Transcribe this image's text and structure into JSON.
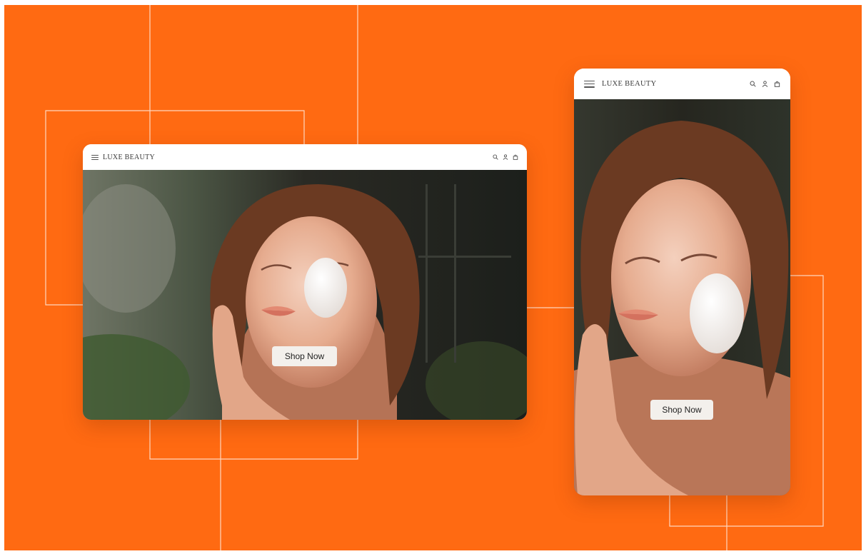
{
  "colors": {
    "background": "#ff6a12",
    "line": "#ffd7bf",
    "navbar": "#ffffff",
    "button": "#f3f0ec"
  },
  "desktop_mockup": {
    "brand": "LUXE BEAUTY",
    "nav_icons": [
      "menu-icon",
      "search-icon",
      "user-icon",
      "bag-icon"
    ],
    "hero_button_label": "Shop Now"
  },
  "mobile_mockup": {
    "brand": "LUXE BEAUTY",
    "nav_icons": [
      "menu-icon",
      "search-icon",
      "user-icon",
      "bag-icon"
    ],
    "hero_button_label": "Shop Now"
  }
}
